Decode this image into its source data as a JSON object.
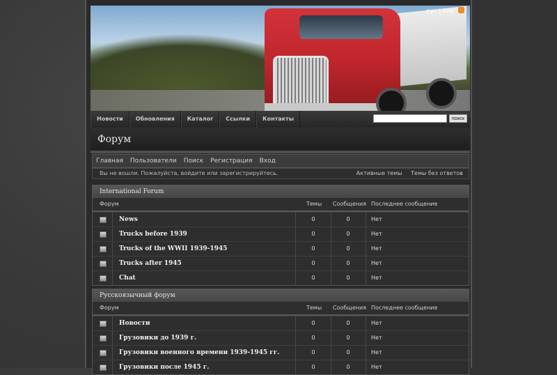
{
  "header": {
    "lang_ru": "рус",
    "lang_sep": "|",
    "lang_en": "eng",
    "rss": "rss-icon"
  },
  "nav": {
    "items": [
      "Новости",
      "Обновления",
      "Каталог",
      "Ссылки",
      "Контакты"
    ],
    "search_button": "поиск",
    "search_value": ""
  },
  "page_title": "Форум",
  "breadcrumb": [
    "Главная",
    "Пользователи",
    "Поиск",
    "Регистрация",
    "Вход"
  ],
  "login_bar": {
    "message": "Вы не вошли. Пожалуйста, войдите или зарегистрируйтесь.",
    "active_topics": "Активные темы",
    "unanswered": "Темы без ответов"
  },
  "columns": {
    "forum": "Форум",
    "topics": "Темы",
    "posts": "Сообщения",
    "last": "Последнее сообщение"
  },
  "sections": [
    {
      "title": "International Forum",
      "rows": [
        {
          "name": "News",
          "topics": "0",
          "posts": "0",
          "last": "Нет"
        },
        {
          "name": "Trucks before 1939",
          "topics": "0",
          "posts": "0",
          "last": "Нет"
        },
        {
          "name": "Trucks of the WWII 1939-1945",
          "topics": "0",
          "posts": "0",
          "last": "Нет"
        },
        {
          "name": "Trucks after 1945",
          "topics": "0",
          "posts": "0",
          "last": "Нет"
        },
        {
          "name": "Chat",
          "topics": "0",
          "posts": "0",
          "last": "Нет"
        }
      ]
    },
    {
      "title": "Русскоязычный форум",
      "rows": [
        {
          "name": "Новости",
          "topics": "0",
          "posts": "0",
          "last": "Нет"
        },
        {
          "name": "Грузовики до 1939 г.",
          "topics": "0",
          "posts": "0",
          "last": "Нет"
        },
        {
          "name": "Грузовики военного времени 1939-1945 гг.",
          "topics": "0",
          "posts": "0",
          "last": "Нет"
        },
        {
          "name": "Грузовики после 1945 г.",
          "topics": "0",
          "posts": "0",
          "last": "Нет"
        }
      ]
    }
  ]
}
